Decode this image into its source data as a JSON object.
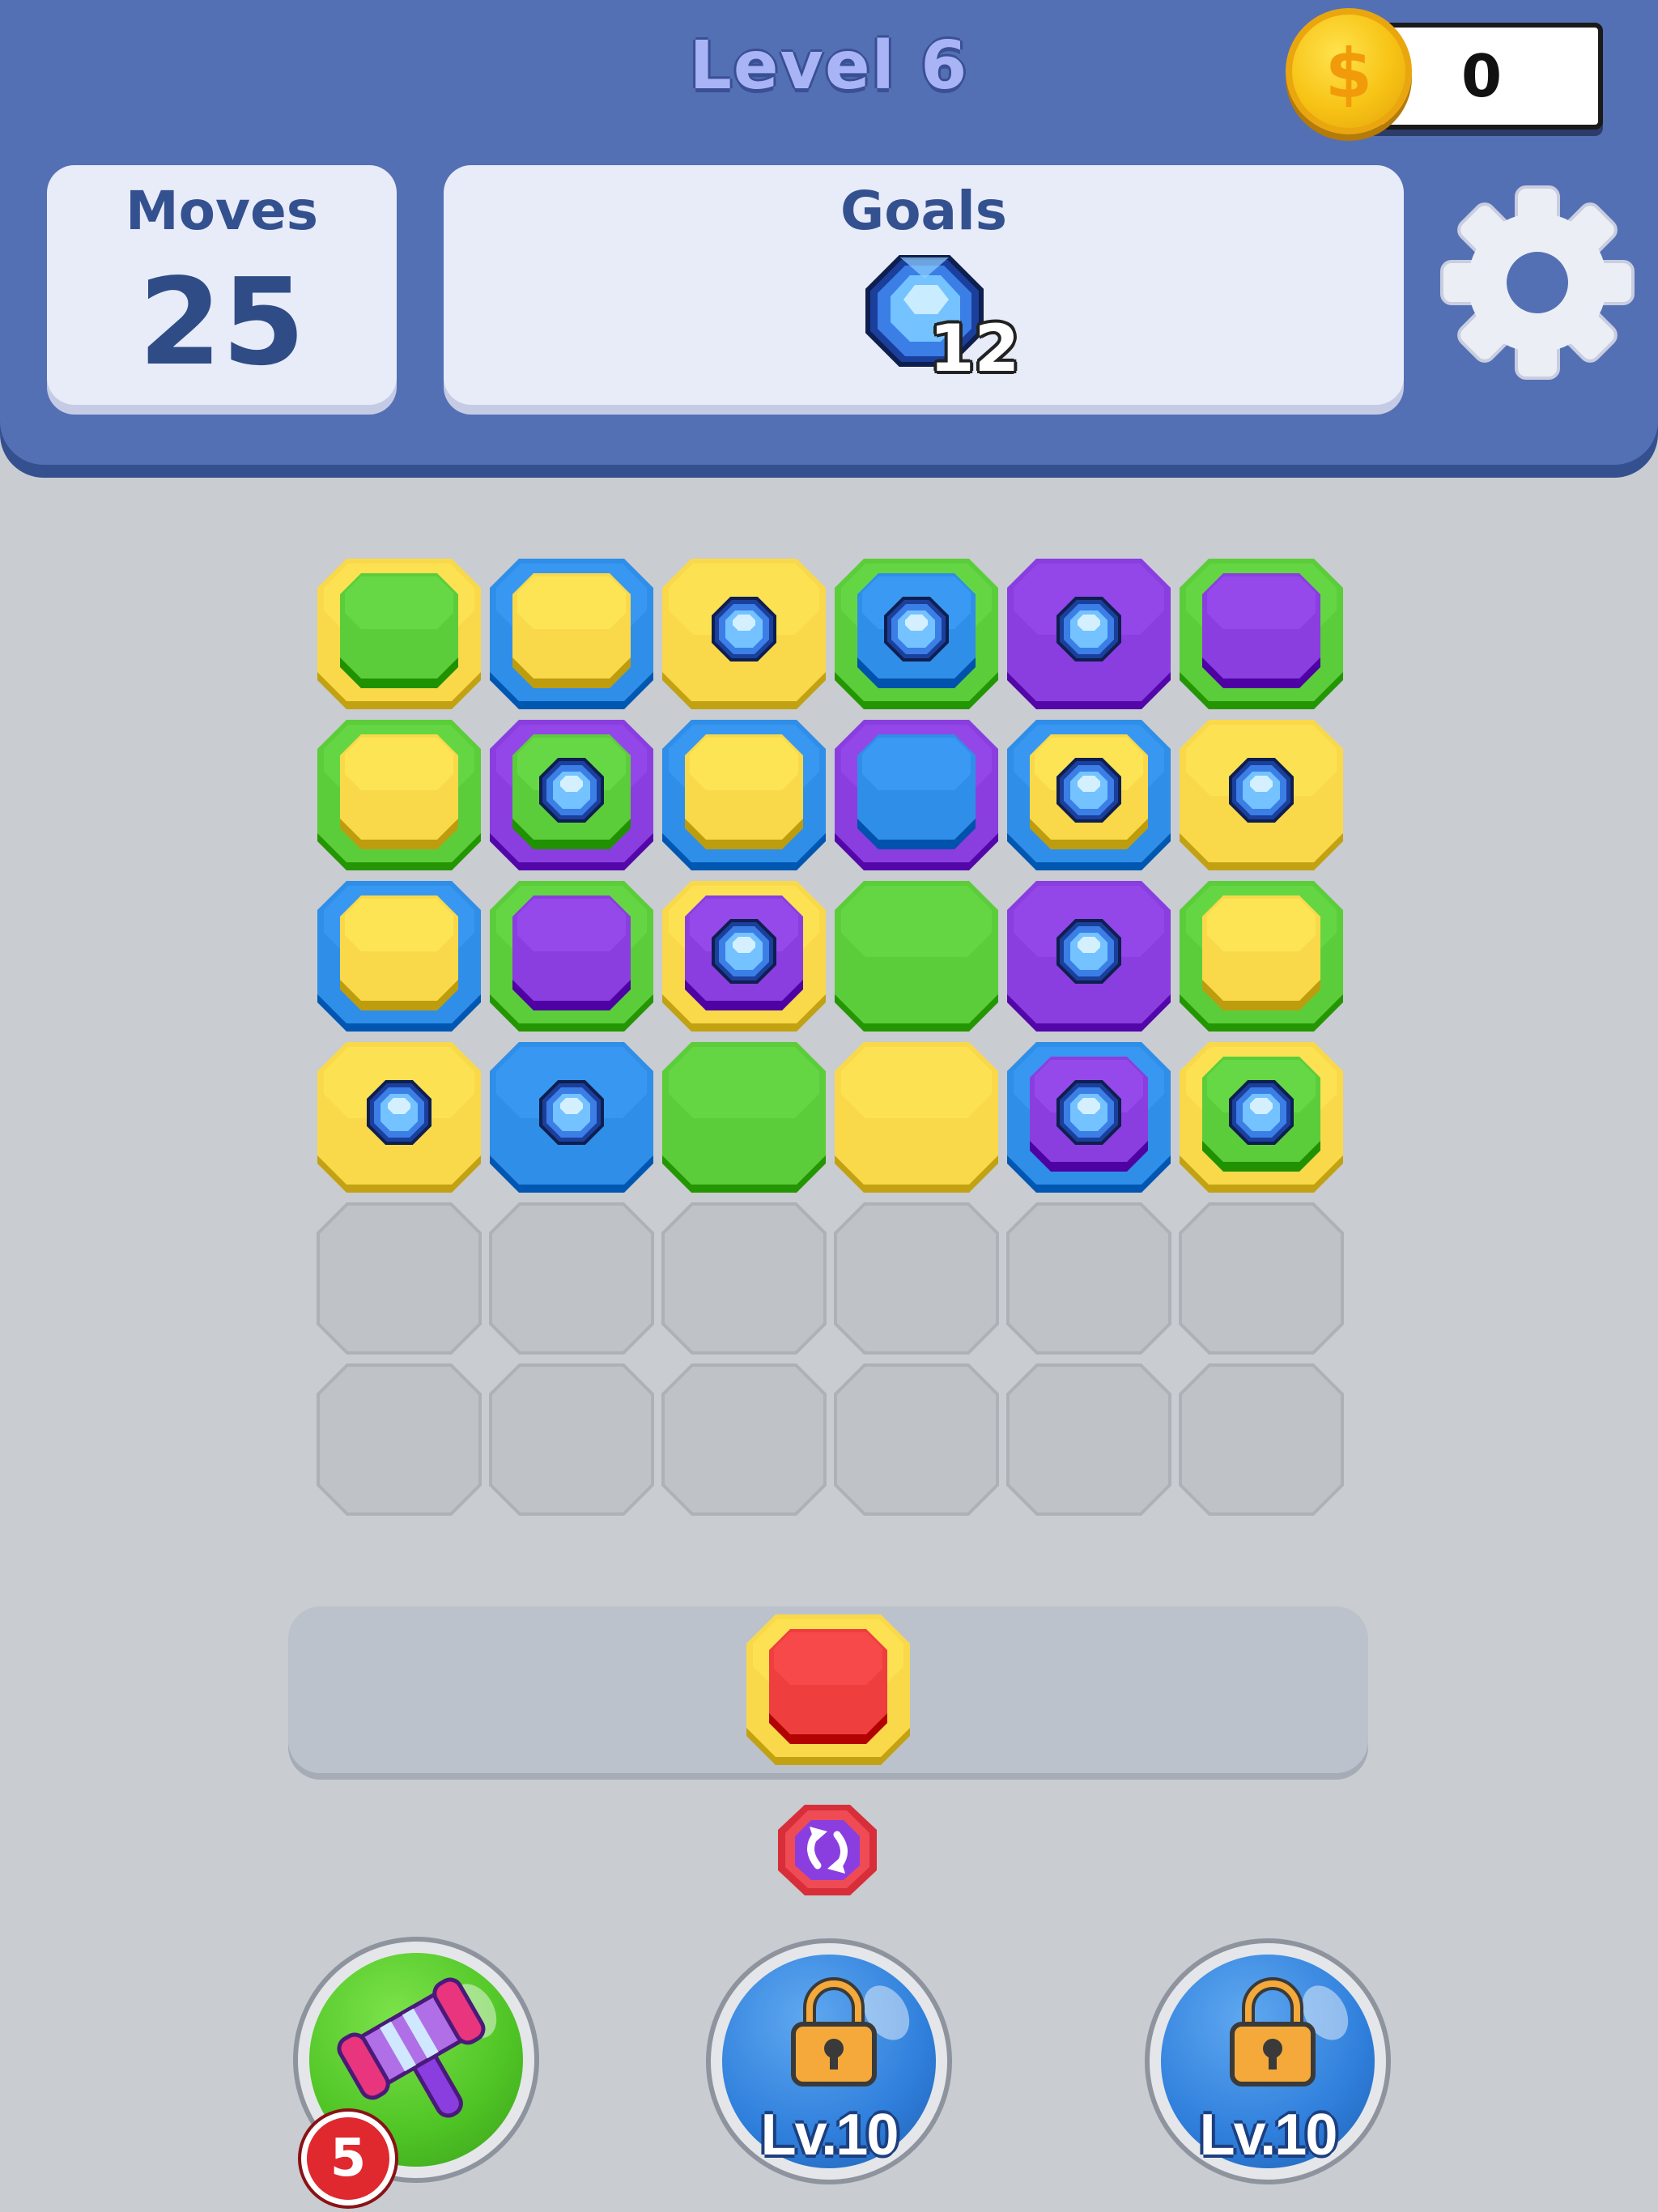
{
  "header": {
    "level_title": "Level 6",
    "coins": "0",
    "coin_symbol": "$",
    "moves_label": "Moves",
    "moves_value": "25",
    "goals_label": "Goals",
    "goal_icon": "blue-gem-icon",
    "goal_count": "12",
    "settings_icon": "gear-icon"
  },
  "colors": {
    "green": "#5ccd3a",
    "yellow": "#f9d94a",
    "blue": "#2f8ee8",
    "purple": "#8a3ee0",
    "red": "#ee3e3e",
    "empty": "#bfc2c7"
  },
  "board": {
    "rows": [
      [
        {
          "outer": "yellow",
          "inner": "green",
          "gem": false
        },
        {
          "outer": "blue",
          "inner": "yellow",
          "gem": false
        },
        {
          "outer": "yellow",
          "inner": null,
          "gem": true
        },
        {
          "outer": "green",
          "inner": "blue",
          "gem": true
        },
        {
          "outer": "purple",
          "inner": null,
          "gem": true
        },
        {
          "outer": "green",
          "inner": "purple",
          "gem": false
        }
      ],
      [
        {
          "outer": "green",
          "inner": "yellow",
          "gem": false
        },
        {
          "outer": "purple",
          "inner": "green",
          "gem": true
        },
        {
          "outer": "blue",
          "inner": "yellow",
          "gem": false
        },
        {
          "outer": "purple",
          "inner": "blue",
          "gem": false
        },
        {
          "outer": "blue",
          "inner": "yellow",
          "gem": true
        },
        {
          "outer": "yellow",
          "inner": null,
          "gem": true
        }
      ],
      [
        {
          "outer": "blue",
          "inner": "yellow",
          "gem": false
        },
        {
          "outer": "green",
          "inner": "purple",
          "gem": false
        },
        {
          "outer": "yellow",
          "inner": "purple",
          "gem": true
        },
        {
          "outer": "green",
          "inner": null,
          "gem": false
        },
        {
          "outer": "purple",
          "inner": null,
          "gem": true
        },
        {
          "outer": "green",
          "inner": "yellow",
          "gem": false
        }
      ],
      [
        {
          "outer": "yellow",
          "inner": null,
          "gem": true
        },
        {
          "outer": "blue",
          "inner": null,
          "gem": true
        },
        {
          "outer": "green",
          "inner": null,
          "gem": false
        },
        {
          "outer": "yellow",
          "inner": null,
          "gem": false
        },
        {
          "outer": "blue",
          "inner": "purple",
          "gem": true
        },
        {
          "outer": "yellow",
          "inner": "green",
          "gem": true
        }
      ],
      [
        {
          "outer": "empty"
        },
        {
          "outer": "empty"
        },
        {
          "outer": "empty"
        },
        {
          "outer": "empty"
        },
        {
          "outer": "empty"
        },
        {
          "outer": "empty"
        }
      ],
      [
        {
          "outer": "empty"
        },
        {
          "outer": "empty"
        },
        {
          "outer": "empty"
        },
        {
          "outer": "empty"
        },
        {
          "outer": "empty"
        },
        {
          "outer": "empty"
        }
      ]
    ]
  },
  "tray": {
    "piece": {
      "outer": "yellow",
      "inner": "red",
      "gem": false
    },
    "swap_icon": "swap-arrows-icon"
  },
  "boosters": [
    {
      "name": "hammer",
      "icon": "hammer-icon",
      "locked": false,
      "count": "5"
    },
    {
      "name": "locked-booster-1",
      "icon": "lock-icon",
      "locked": true,
      "label": "Lv.10"
    },
    {
      "name": "locked-booster-2",
      "icon": "lock-icon",
      "locked": true,
      "label": "Lv.10"
    }
  ]
}
